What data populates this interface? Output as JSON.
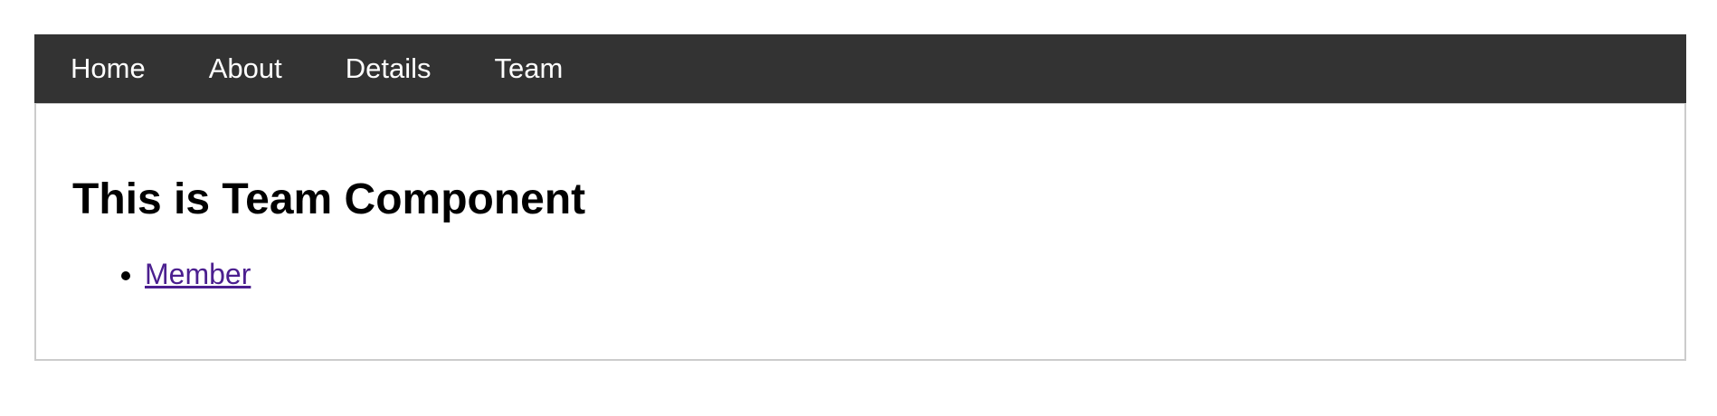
{
  "nav": {
    "items": [
      {
        "label": "Home"
      },
      {
        "label": "About"
      },
      {
        "label": "Details"
      },
      {
        "label": "Team"
      }
    ]
  },
  "main": {
    "title": "This is Team Component",
    "links": [
      {
        "label": "Member"
      }
    ]
  },
  "colors": {
    "navbar_bg": "#333333",
    "nav_text": "#ffffff",
    "link_visited": "#4b1f8f",
    "panel_border": "#cccccc"
  }
}
